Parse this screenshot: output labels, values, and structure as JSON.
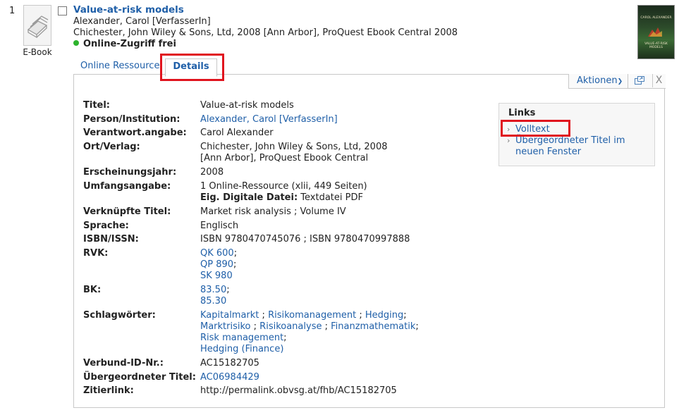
{
  "result": {
    "number": "1",
    "type_label": "E-Book",
    "type_icon": "book-stack-icon",
    "title": "Value-at-risk models",
    "author_line": "Alexander, Carol [VerfasserIn]",
    "publication_line": "Chichester, John Wiley & Sons, Ltd, 2008 [Ann Arbor], ProQuest Ebook Central 2008",
    "availability": "Online-Zugriff frei",
    "availability_color": "#2db32d"
  },
  "cover": {
    "top_text": "CAROL ALEXANDER",
    "title_text": "VALUE-AT-RISK MODELS"
  },
  "tabs": [
    {
      "label": "Online Ressource"
    },
    {
      "label": "Details"
    }
  ],
  "toolbar": {
    "actions_label": "Aktionen",
    "popout_icon": "popout-window-icon",
    "close_label": "X"
  },
  "details": {
    "titel_label": "Titel:",
    "titel_value": "Value-at-risk models",
    "person_label": "Person/Institution:",
    "person_value": "Alexander, Carol [VerfasserIn]",
    "verantwort_label": "Verantwort.angabe:",
    "verantwort_value": "Carol Alexander",
    "ort_label": "Ort/Verlag:",
    "ort_value_1": "Chichester, John Wiley & Sons, Ltd, 2008",
    "ort_value_2": "[Ann Arbor], ProQuest Ebook Central",
    "jahr_label": "Erscheinungsjahr:",
    "jahr_value": "2008",
    "umfang_label": "Umfangsangabe:",
    "umfang_value": "1 Online-Ressource (xlii, 449 Seiten)",
    "umfang_sub_label": "Eig. Digitale Datei:",
    "umfang_sub_value": " Textdatei PDF",
    "verknuepft_label": "Verknüpfte Titel:",
    "verknuepft_value": "Market risk analysis ; Volume IV",
    "sprache_label": "Sprache:",
    "sprache_value": "Englisch",
    "isbn_label": "ISBN/ISSN:",
    "isbn_value": "ISBN 9780470745076 ; ISBN 9780470997888",
    "rvk_label": "RVK:",
    "rvk_values": [
      "QK 600",
      "QP 890",
      "SK 980"
    ],
    "bk_label": "BK:",
    "bk_values": [
      "83.50",
      "85.30"
    ],
    "schlag_label": "Schlagwörter:",
    "schlag_values": [
      "Kapitalmarkt",
      "Risikomanagement",
      "Hedging",
      "Marktrisiko",
      "Risikoanalyse",
      "Finanzmathematik",
      "Risk management",
      "Hedging (Finance)"
    ],
    "verbund_label": "Verbund-ID-Nr.:",
    "verbund_value": "AC15182705",
    "uebergeordnet_label": "Übergeordneter Titel:",
    "uebergeordnet_value": "AC06984429",
    "zitier_label": "Zitierlink:",
    "zitier_value": "http://permalink.obvsg.at/fhb/AC15182705"
  },
  "links_box": {
    "title": "Links",
    "items": [
      "Volltext",
      "Übergeordneter Titel im",
      "neuen Fenster"
    ]
  },
  "highlight_color": "#e0141e"
}
